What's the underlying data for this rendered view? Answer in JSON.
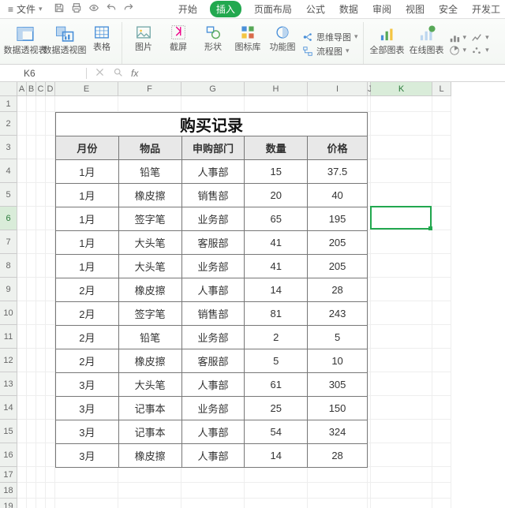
{
  "titlebar": {
    "file_label": "文件"
  },
  "tabs": {
    "start": "开始",
    "insert": "插入",
    "layout": "页面布局",
    "formula": "公式",
    "data": "数据",
    "review": "审阅",
    "view": "视图",
    "security": "安全",
    "dev": "开发工"
  },
  "ribbon": {
    "pivot_table": "数据透视表",
    "pivot_chart": "数据透视图",
    "table": "表格",
    "picture": "图片",
    "screenshot": "截屏",
    "shapes": "形状",
    "icons": "图标库",
    "smartart": "功能图",
    "mindmap": "思维导图",
    "flowchart": "流程图",
    "all_charts": "全部图表",
    "online_chart": "在线图表"
  },
  "formula_bar": {
    "cell_ref": "K6",
    "fx": "fx"
  },
  "sheet": {
    "col_widths": {
      "A": 12,
      "B": 12,
      "C": 12,
      "D": 12,
      "E": 80,
      "F": 80,
      "G": 80,
      "H": 80,
      "I": 76,
      "J": 4,
      "K": 78,
      "L": 24
    },
    "row_heights": {
      "default": 20,
      "fat": 30
    },
    "active_cell": "K6",
    "rows_visible": 19,
    "fat_rows": [
      2,
      3,
      4,
      5,
      6,
      7,
      8,
      9,
      10,
      11,
      12,
      13,
      14,
      15,
      16
    ]
  },
  "table": {
    "title": "购买记录",
    "headers": [
      "月份",
      "物品",
      "申购部门",
      "数量",
      "价格"
    ],
    "rows": [
      [
        "1月",
        "铅笔",
        "人事部",
        "15",
        "37.5"
      ],
      [
        "1月",
        "橡皮擦",
        "销售部",
        "20",
        "40"
      ],
      [
        "1月",
        "签字笔",
        "业务部",
        "65",
        "195"
      ],
      [
        "1月",
        "大头笔",
        "客服部",
        "41",
        "205"
      ],
      [
        "1月",
        "大头笔",
        "业务部",
        "41",
        "205"
      ],
      [
        "2月",
        "橡皮擦",
        "人事部",
        "14",
        "28"
      ],
      [
        "2月",
        "签字笔",
        "销售部",
        "81",
        "243"
      ],
      [
        "2月",
        "铅笔",
        "业务部",
        "2",
        "5"
      ],
      [
        "2月",
        "橡皮擦",
        "客服部",
        "5",
        "10"
      ],
      [
        "3月",
        "大头笔",
        "人事部",
        "61",
        "305"
      ],
      [
        "3月",
        "记事本",
        "业务部",
        "25",
        "150"
      ],
      [
        "3月",
        "记事本",
        "人事部",
        "54",
        "324"
      ],
      [
        "3月",
        "橡皮擦",
        "人事部",
        "14",
        "28"
      ]
    ]
  }
}
